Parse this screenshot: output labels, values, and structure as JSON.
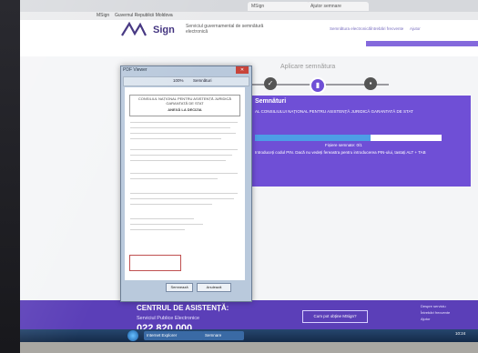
{
  "browser": {
    "tabs": [
      "MSign",
      "Ajutor semnare"
    ],
    "bookmarks": [
      "MSign",
      "Guvernul Republicii Moldova"
    ]
  },
  "header": {
    "logo": "Sign",
    "tagline": "Serviciul guvernamental de semnătură electronică",
    "links": [
      "Semnătura electronică",
      "Întrebări frecvente",
      "Ajutor"
    ],
    "user": "Ajutor"
  },
  "steps": {
    "title": "Aplicare semnătura",
    "icons": [
      "check-icon",
      "document-icon",
      "lock-icon"
    ]
  },
  "panel": {
    "title": "Semnături",
    "subtitle": "AL CONSILIULUI NAȚIONAL PENTRU ASISTENȚĂ JURIDICĂ GARANTATĂ DE STAT",
    "progress_label": "Fișiere semnate: 0/1",
    "progress_fraction": 0.62,
    "note": "Introduceți codul PIN. Dacă nu vedeți fereastra pentru introducerea PIN-ului, tastați ALT + TAB"
  },
  "viewer": {
    "title": "PDF Viewer",
    "zoom": "100%",
    "signature_panel": "Semnături",
    "doc_heading": "CONSILIUL NAȚIONAL PENTRU ASISTENȚĂ JURIDICĂ GARANTATĂ DE STAT",
    "doc_sub": "ANEXĂ LA DECIZIA",
    "buttons": [
      "Semnează",
      "Anulează"
    ]
  },
  "footer": {
    "help_title": "CENTRUL DE ASISTENȚĂ:",
    "help_service": "Serviciul Publice Electronice",
    "help_phone": "022 820 000",
    "help_button": "Cum pot obține MSign?",
    "links": [
      "Despre serviciu",
      "Întrebări frecvente",
      "Ajutor"
    ]
  },
  "taskbar": {
    "items": [
      "Internet Explorer",
      "Semnare"
    ],
    "time": "10:24"
  },
  "colors": {
    "brand_purple": "#6f4fd6",
    "footer_purple": "#5b3fb8",
    "progress_blue": "#4d9de6"
  }
}
